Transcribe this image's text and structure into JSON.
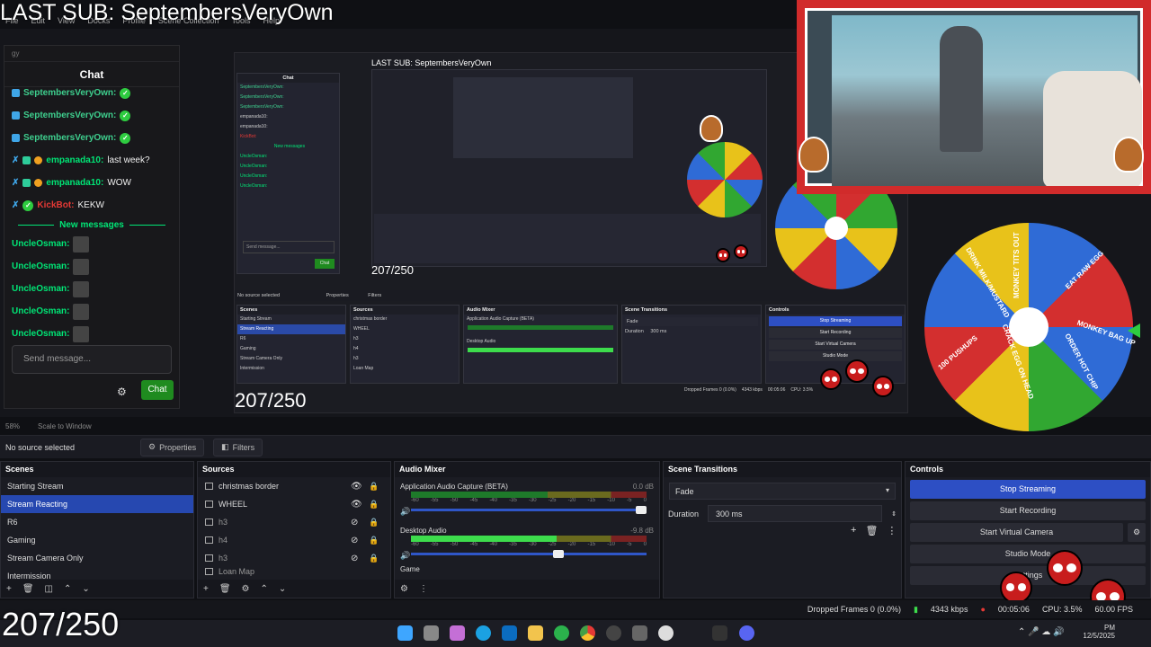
{
  "overlay": {
    "last_sub": "LAST SUB: SeptembersVeryOwn",
    "counter": "207/250"
  },
  "menubar": [
    "File",
    "Edit",
    "View",
    "Docks",
    "Profile",
    "Scene Collection",
    "Tools",
    "Help"
  ],
  "chat": {
    "search_placeholder": "gy",
    "title": "Chat",
    "messages": [
      {
        "user": "SeptembersVeryOwn:",
        "text": ""
      },
      {
        "user": "SeptembersVeryOwn:",
        "text": ""
      },
      {
        "user": "SeptembersVeryOwn:",
        "text": ""
      },
      {
        "user": "empanada10:",
        "text": "last week?"
      },
      {
        "user": "empanada10:",
        "text": "WOW"
      },
      {
        "user": "KickBot:",
        "text": "KEKW"
      }
    ],
    "new_messages_label": "New messages",
    "recent": [
      "UncleOsman:",
      "UncleOsman:",
      "UncleOsman:",
      "UncleOsman:",
      "UncleOsman:"
    ],
    "send_placeholder": "Send message...",
    "chat_button": "Chat"
  },
  "wheel_labels": [
    "MONKEY TITS OUT",
    "EAT RAW EGG",
    "MONKEY BAG UP",
    "ORDER HOT CHIP",
    "CRACK EGG ON HEAD",
    "100 PUSHUPS",
    "DRINK MILK/MUSTARD"
  ],
  "zoombar": {
    "zoom": "58%",
    "scale": "Scale to Window"
  },
  "context": {
    "source": "No source selected",
    "properties": "Properties",
    "filters": "Filters"
  },
  "scenes": {
    "title": "Scenes",
    "items": [
      "Starting Stream",
      "Stream Reacting",
      "R6",
      "Gaming",
      "Stream Camera Only",
      "Intermission"
    ],
    "selected_index": 1
  },
  "sources": {
    "title": "Sources",
    "items": [
      "christmas border",
      "WHEEL",
      "h3",
      "h4",
      "h3",
      "Loan Map"
    ]
  },
  "mixer": {
    "title": "Audio Mixer",
    "channels": [
      {
        "name": "Application Audio Capture (BETA)",
        "db": "0.0 dB",
        "level": 0.0,
        "volume": 1.0
      },
      {
        "name": "Desktop Audio",
        "db": "-9.8 dB",
        "level": 0.62,
        "volume": 0.65
      }
    ],
    "ticks": [
      "-60",
      "-55",
      "-50",
      "-45",
      "-40",
      "-35",
      "-30",
      "-25",
      "-20",
      "-15",
      "-10",
      "-5",
      "0"
    ],
    "extra": "Game"
  },
  "transitions": {
    "title": "Scene Transitions",
    "type": "Fade",
    "duration_label": "Duration",
    "duration_value": "300 ms"
  },
  "controls": {
    "title": "Controls",
    "buttons": [
      "Stop Streaming",
      "Start Recording",
      "Start Virtual Camera",
      "Studio Mode",
      "Settings"
    ]
  },
  "status": {
    "dropped": "Dropped Frames 0 (0.0%)",
    "kbps": "4343 kbps",
    "time": "00:05:06",
    "cpu": "CPU: 3.5%",
    "fps": "60.00 FPS"
  },
  "clock": {
    "time": "PM",
    "date": "12/5/2025"
  },
  "nested": {
    "chat_title": "Chat",
    "new_messages": "New messages",
    "send": "Send message...",
    "chat_button": "Chat",
    "no_source": "No source selected",
    "properties": "Properties",
    "filters": "Filters",
    "scenes_title": "Scenes",
    "scenes": [
      "Starting Stream",
      "Stream Reacting",
      "R6",
      "Gaming",
      "Stream Camera Only",
      "Intermission"
    ],
    "sources_title": "Sources",
    "sources": [
      "christmas border",
      "WHEEL",
      "h3",
      "h4",
      "h3",
      "Loan Map"
    ],
    "mixer_title": "Audio Mixer",
    "app_audio": "Application Audio Capture (BETA)",
    "desktop_audio": "Desktop Audio",
    "transitions_title": "Scene Transitions",
    "fade": "Fade",
    "duration": "Duration",
    "duration_value": "300 ms",
    "controls_title": "Controls",
    "controls": [
      "Stop Streaming",
      "Start Recording",
      "Start Virtual Camera",
      "Studio Mode"
    ],
    "dropped": "Dropped Frames 0 (0.0%)",
    "kbps": "4343 kbps",
    "time": "00:05:06",
    "cpu": "CPU: 3.5%"
  }
}
